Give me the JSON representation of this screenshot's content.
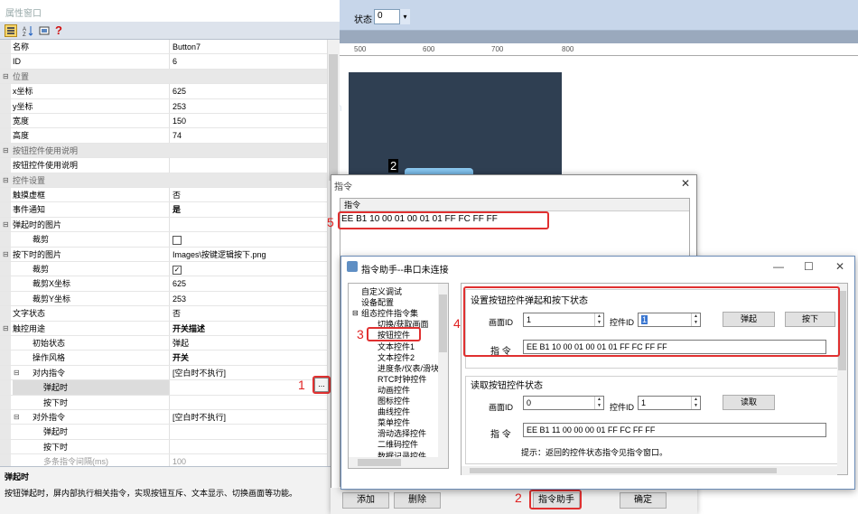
{
  "toolbar": {
    "status_label": "状态",
    "status_value": "0",
    "dropdown_glyph": "▾"
  },
  "ruler": {
    "ticks": [
      "500",
      "600",
      "700",
      "800"
    ]
  },
  "canvas": {
    "screen_text": "n",
    "marker": "2"
  },
  "props": {
    "title": "属性窗口",
    "help_glyph": "?",
    "rows": [
      {
        "type": "prop",
        "k": "名称",
        "v": "Button7"
      },
      {
        "type": "prop",
        "k": "ID",
        "v": "6"
      },
      {
        "type": "cat",
        "k": "位置"
      },
      {
        "type": "prop",
        "k": "x坐标",
        "v": "625"
      },
      {
        "type": "prop",
        "k": "y坐标",
        "v": "253"
      },
      {
        "type": "prop",
        "k": "宽度",
        "v": "150"
      },
      {
        "type": "prop",
        "k": "高度",
        "v": "74"
      },
      {
        "type": "cat",
        "k": "按钮控件使用说明"
      },
      {
        "type": "prop",
        "k": "按钮控件使用说明",
        "v": ""
      },
      {
        "type": "cat",
        "k": "控件设置"
      },
      {
        "type": "prop",
        "k": "触摸虚框",
        "v": "否"
      },
      {
        "type": "prop",
        "k": "事件通知",
        "v": "是",
        "bold": true
      },
      {
        "type": "sub",
        "k": "弹起时的图片",
        "v": "",
        "tog": "⊟"
      },
      {
        "type": "prop",
        "k": "裁剪",
        "v": "",
        "cb": "",
        "indent": 1
      },
      {
        "type": "sub",
        "k": "按下时的图片",
        "v": "Images\\按键逻辑按下.png",
        "tog": "⊟"
      },
      {
        "type": "prop",
        "k": "裁剪",
        "v": "",
        "cb": "✓",
        "indent": 1
      },
      {
        "type": "prop",
        "k": "裁剪X坐标",
        "v": "625",
        "indent": 1
      },
      {
        "type": "prop",
        "k": "裁剪Y坐标",
        "v": "253",
        "indent": 1
      },
      {
        "type": "prop",
        "k": "文字状态",
        "v": "否"
      },
      {
        "type": "sub",
        "k": "触控用途",
        "v": "开关描述",
        "tog": "⊟",
        "bold": true
      },
      {
        "type": "prop",
        "k": "初始状态",
        "v": "弹起",
        "indent": 1
      },
      {
        "type": "prop",
        "k": "操作风格",
        "v": "开关",
        "indent": 1,
        "bold": true
      },
      {
        "type": "sub",
        "k": "对内指令",
        "v": "[空白时不执行]",
        "tog": "⊟",
        "indent": 1
      },
      {
        "type": "prop",
        "k": "弹起时",
        "v": "",
        "indent": 2,
        "sel": true
      },
      {
        "type": "prop",
        "k": "按下时",
        "v": "",
        "indent": 2
      },
      {
        "type": "sub",
        "k": "对外指令",
        "v": "[空白时不执行]",
        "tog": "⊟",
        "indent": 1
      },
      {
        "type": "prop",
        "k": "弹起时",
        "v": "",
        "indent": 2
      },
      {
        "type": "prop",
        "k": "按下时",
        "v": "",
        "indent": 2
      },
      {
        "type": "prop",
        "k": "多条指令间隔(ms)",
        "v": "100",
        "indent": 2,
        "dim": true
      }
    ],
    "ellipsis": "...",
    "desc_title": "弹起时",
    "desc_text": "按钮弹起时，屏内部执行相关指令，实现按钮互斥、文本显示、切换画面等功能。"
  },
  "annotations": {
    "n1": "1",
    "n2": "2",
    "n3": "3",
    "n4": "4",
    "n5": "5"
  },
  "cmd_dialog": {
    "title": "指令",
    "close": "✕",
    "column": "指令",
    "row_value": "EE B1 10 00 01 00 01 01 FF FC FF FF",
    "btn_add": "添加",
    "btn_delete": "删除",
    "btn_helper": "指令助手",
    "btn_ok": "确定"
  },
  "helper_dialog": {
    "title": "指令助手--串口未连接",
    "minimize": "—",
    "maximize": "☐",
    "close": "✕",
    "tree": [
      {
        "t": "自定义调试",
        "l": 1
      },
      {
        "t": "设备配置",
        "l": 1
      },
      {
        "t": "组态控件指令集",
        "l": 1,
        "tog": "⊟"
      },
      {
        "t": "切换/获取画面",
        "l": 2
      },
      {
        "t": "按钮控件",
        "l": 2,
        "sel": true
      },
      {
        "t": "文本控件1",
        "l": 2
      },
      {
        "t": "文本控件2",
        "l": 2
      },
      {
        "t": "进度条/仪表/滑块",
        "l": 2
      },
      {
        "t": "RTC时钟控件",
        "l": 2
      },
      {
        "t": "动画控件",
        "l": 2
      },
      {
        "t": "图标控件",
        "l": 2
      },
      {
        "t": "曲线控件",
        "l": 2
      },
      {
        "t": "菜单控件",
        "l": 2
      },
      {
        "t": "滑动选择控件",
        "l": 2
      },
      {
        "t": "二维码控件",
        "l": 2
      },
      {
        "t": "数据记录控件",
        "l": 2
      },
      {
        "t": "历史曲线",
        "l": 2
      }
    ],
    "sec1": {
      "title": "设置按钮控件弹起和按下状态",
      "screen_label": "画面ID",
      "screen_val": "1",
      "ctrl_label": "控件ID",
      "ctrl_val": "1",
      "btn_up": "弹起",
      "btn_down": "按下",
      "cmd_label": "指  令",
      "cmd_val": "EE B1 10 00 01 00 01 01 FF FC FF FF"
    },
    "sec2": {
      "title": "读取按钮控件状态",
      "screen_label": "画面ID",
      "screen_val": "0",
      "ctrl_label": "控件ID",
      "ctrl_val": "1",
      "btn_read": "读取",
      "cmd_label": "指  令",
      "cmd_val": "EE B1 11 00 00 00 01 FF FC FF FF",
      "hint": "提示：返回的控件状态指令见指令窗口。"
    }
  }
}
